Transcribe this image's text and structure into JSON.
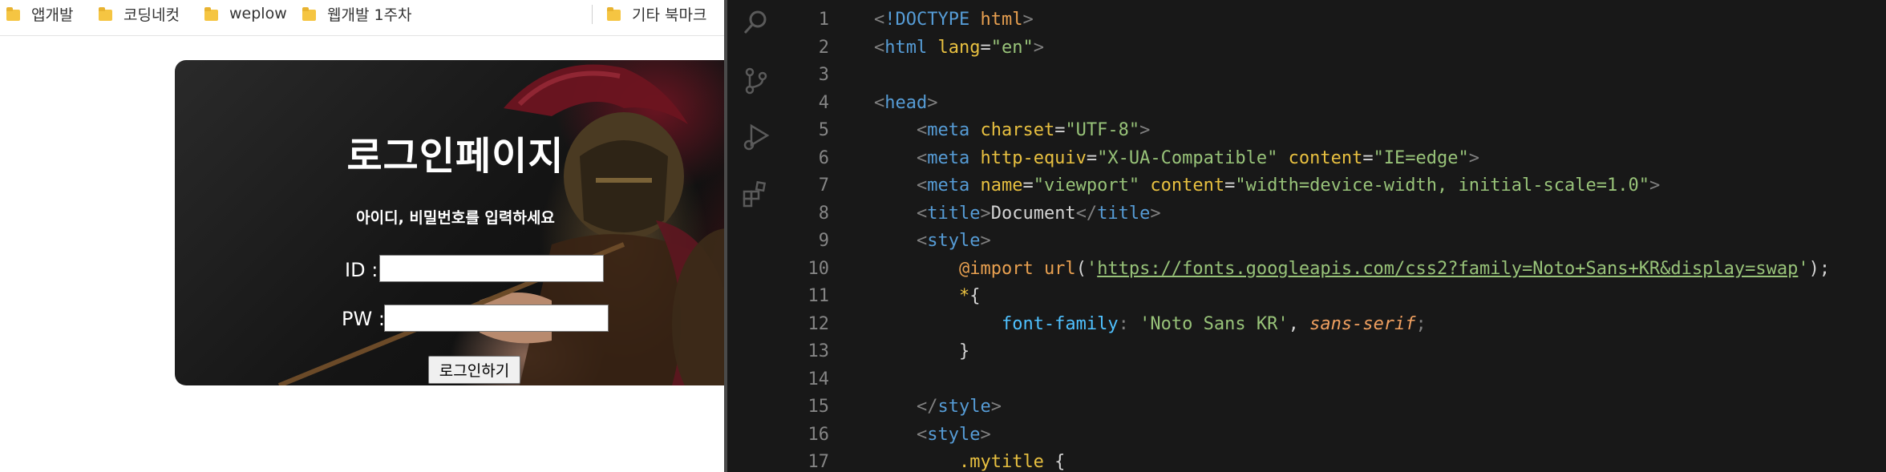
{
  "bookmarks": {
    "items": [
      {
        "label": "앱개발"
      },
      {
        "label": "코딩네컷"
      },
      {
        "label": "weplow"
      },
      {
        "label": "웹개발 1주차"
      },
      {
        "label": "기타 북마크"
      }
    ]
  },
  "login_page": {
    "title": "로그인페이지",
    "subtitle": "아이디, 비밀번호를 입력하세요",
    "id_label": "ID :",
    "pw_label": "PW :",
    "id_value": "",
    "pw_value": "",
    "button_label": "로그인하기"
  },
  "editor": {
    "lines": [
      {
        "n": "1",
        "tokens": [
          [
            "t-punc",
            "<"
          ],
          [
            "t-doctype",
            "!DOCTYPE"
          ],
          [
            "t-plain",
            " "
          ],
          [
            "t-kw",
            "html"
          ],
          [
            "t-punc",
            ">"
          ]
        ]
      },
      {
        "n": "2",
        "tokens": [
          [
            "t-punc",
            "<"
          ],
          [
            "t-tag",
            "html"
          ],
          [
            "t-plain",
            " "
          ],
          [
            "t-attr",
            "lang"
          ],
          [
            "t-plain",
            "="
          ],
          [
            "t-str",
            "\"en\""
          ],
          [
            "t-punc",
            ">"
          ]
        ]
      },
      {
        "n": "3",
        "tokens": []
      },
      {
        "n": "4",
        "tokens": [
          [
            "t-punc",
            "<"
          ],
          [
            "t-tag",
            "head"
          ],
          [
            "t-punc",
            ">"
          ]
        ]
      },
      {
        "n": "5",
        "tokens": [
          [
            "t-plain",
            "    "
          ],
          [
            "t-punc",
            "<"
          ],
          [
            "t-tag",
            "meta"
          ],
          [
            "t-plain",
            " "
          ],
          [
            "t-attr",
            "charset"
          ],
          [
            "t-plain",
            "="
          ],
          [
            "t-str",
            "\"UTF-8\""
          ],
          [
            "t-punc",
            ">"
          ]
        ]
      },
      {
        "n": "6",
        "tokens": [
          [
            "t-plain",
            "    "
          ],
          [
            "t-punc",
            "<"
          ],
          [
            "t-tag",
            "meta"
          ],
          [
            "t-plain",
            " "
          ],
          [
            "t-attr",
            "http-equiv"
          ],
          [
            "t-plain",
            "="
          ],
          [
            "t-str",
            "\"X-UA-Compatible\""
          ],
          [
            "t-plain",
            " "
          ],
          [
            "t-attr",
            "content"
          ],
          [
            "t-plain",
            "="
          ],
          [
            "t-str",
            "\"IE=edge\""
          ],
          [
            "t-punc",
            ">"
          ]
        ]
      },
      {
        "n": "7",
        "tokens": [
          [
            "t-plain",
            "    "
          ],
          [
            "t-punc",
            "<"
          ],
          [
            "t-tag",
            "meta"
          ],
          [
            "t-plain",
            " "
          ],
          [
            "t-attr",
            "name"
          ],
          [
            "t-plain",
            "="
          ],
          [
            "t-str",
            "\"viewport\""
          ],
          [
            "t-plain",
            " "
          ],
          [
            "t-attr",
            "content"
          ],
          [
            "t-plain",
            "="
          ],
          [
            "t-str",
            "\"width=device-width, initial-scale=1.0\""
          ],
          [
            "t-punc",
            ">"
          ]
        ]
      },
      {
        "n": "8",
        "tokens": [
          [
            "t-plain",
            "    "
          ],
          [
            "t-punc",
            "<"
          ],
          [
            "t-tag",
            "title"
          ],
          [
            "t-punc",
            ">"
          ],
          [
            "t-plain",
            "Document"
          ],
          [
            "t-punc",
            "</"
          ],
          [
            "t-tag",
            "title"
          ],
          [
            "t-punc",
            ">"
          ]
        ]
      },
      {
        "n": "9",
        "tokens": [
          [
            "t-plain",
            "    "
          ],
          [
            "t-punc",
            "<"
          ],
          [
            "t-tag",
            "style"
          ],
          [
            "t-punc",
            ">"
          ]
        ]
      },
      {
        "n": "10",
        "tokens": [
          [
            "t-plain",
            "        "
          ],
          [
            "t-at",
            "@import"
          ],
          [
            "t-plain",
            " "
          ],
          [
            "t-fn",
            "url"
          ],
          [
            "t-plain",
            "("
          ],
          [
            "t-str",
            "'"
          ],
          [
            "t-url",
            "https://fonts.googleapis.com/css2?family=Noto+Sans+KR&display=swap"
          ],
          [
            "t-str",
            "'"
          ],
          [
            "t-plain",
            ");"
          ]
        ]
      },
      {
        "n": "11",
        "tokens": [
          [
            "t-plain",
            "        "
          ],
          [
            "t-sel",
            "*"
          ],
          [
            "t-plain",
            "{"
          ]
        ]
      },
      {
        "n": "12",
        "tokens": [
          [
            "t-plain",
            "            "
          ],
          [
            "t-prop",
            "font-family"
          ],
          [
            "t-colon",
            ": "
          ],
          [
            "t-str",
            "'Noto Sans KR'"
          ],
          [
            "t-plain",
            ", "
          ],
          [
            "t-ital",
            "sans-serif"
          ],
          [
            "t-colon",
            ";"
          ]
        ]
      },
      {
        "n": "13",
        "tokens": [
          [
            "t-plain",
            "        "
          ],
          [
            "t-plain",
            "}"
          ]
        ]
      },
      {
        "n": "14",
        "tokens": []
      },
      {
        "n": "15",
        "tokens": [
          [
            "t-plain",
            "    "
          ],
          [
            "t-punc",
            "</"
          ],
          [
            "t-tag",
            "style"
          ],
          [
            "t-punc",
            ">"
          ]
        ]
      },
      {
        "n": "16",
        "tokens": [
          [
            "t-plain",
            "    "
          ],
          [
            "t-punc",
            "<"
          ],
          [
            "t-tag",
            "style"
          ],
          [
            "t-punc",
            ">"
          ]
        ]
      },
      {
        "n": "17",
        "tokens": [
          [
            "t-plain",
            "        "
          ],
          [
            "t-sel",
            ".mytitle"
          ],
          [
            "t-plain",
            " {"
          ]
        ]
      }
    ]
  },
  "colors": {
    "editor_bg": "#181818",
    "line_number": "#858585",
    "folder": "#f5c542"
  },
  "icons": [
    "folder-icon",
    "search-icon",
    "source-control-icon",
    "run-debug-icon",
    "extensions-icon"
  ]
}
